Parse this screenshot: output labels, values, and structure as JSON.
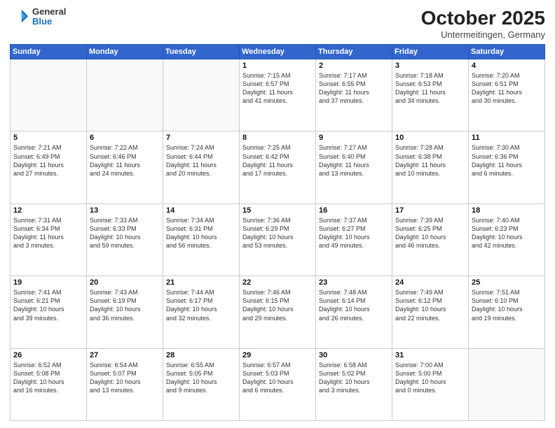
{
  "header": {
    "logo_general": "General",
    "logo_blue": "Blue",
    "title": "October 2025",
    "location": "Untermeitingen, Germany"
  },
  "days_of_week": [
    "Sunday",
    "Monday",
    "Tuesday",
    "Wednesday",
    "Thursday",
    "Friday",
    "Saturday"
  ],
  "weeks": [
    [
      {
        "day": "",
        "info": ""
      },
      {
        "day": "",
        "info": ""
      },
      {
        "day": "",
        "info": ""
      },
      {
        "day": "1",
        "info": "Sunrise: 7:15 AM\nSunset: 6:57 PM\nDaylight: 11 hours\nand 41 minutes."
      },
      {
        "day": "2",
        "info": "Sunrise: 7:17 AM\nSunset: 6:55 PM\nDaylight: 11 hours\nand 37 minutes."
      },
      {
        "day": "3",
        "info": "Sunrise: 7:18 AM\nSunset: 6:53 PM\nDaylight: 11 hours\nand 34 minutes."
      },
      {
        "day": "4",
        "info": "Sunrise: 7:20 AM\nSunset: 6:51 PM\nDaylight: 11 hours\nand 30 minutes."
      }
    ],
    [
      {
        "day": "5",
        "info": "Sunrise: 7:21 AM\nSunset: 6:49 PM\nDaylight: 11 hours\nand 27 minutes."
      },
      {
        "day": "6",
        "info": "Sunrise: 7:22 AM\nSunset: 6:46 PM\nDaylight: 11 hours\nand 24 minutes."
      },
      {
        "day": "7",
        "info": "Sunrise: 7:24 AM\nSunset: 6:44 PM\nDaylight: 11 hours\nand 20 minutes."
      },
      {
        "day": "8",
        "info": "Sunrise: 7:25 AM\nSunset: 6:42 PM\nDaylight: 11 hours\nand 17 minutes."
      },
      {
        "day": "9",
        "info": "Sunrise: 7:27 AM\nSunset: 6:40 PM\nDaylight: 11 hours\nand 13 minutes."
      },
      {
        "day": "10",
        "info": "Sunrise: 7:28 AM\nSunset: 6:38 PM\nDaylight: 11 hours\nand 10 minutes."
      },
      {
        "day": "11",
        "info": "Sunrise: 7:30 AM\nSunset: 6:36 PM\nDaylight: 11 hours\nand 6 minutes."
      }
    ],
    [
      {
        "day": "12",
        "info": "Sunrise: 7:31 AM\nSunset: 6:34 PM\nDaylight: 11 hours\nand 3 minutes."
      },
      {
        "day": "13",
        "info": "Sunrise: 7:33 AM\nSunset: 6:33 PM\nDaylight: 10 hours\nand 59 minutes."
      },
      {
        "day": "14",
        "info": "Sunrise: 7:34 AM\nSunset: 6:31 PM\nDaylight: 10 hours\nand 56 minutes."
      },
      {
        "day": "15",
        "info": "Sunrise: 7:36 AM\nSunset: 6:29 PM\nDaylight: 10 hours\nand 53 minutes."
      },
      {
        "day": "16",
        "info": "Sunrise: 7:37 AM\nSunset: 6:27 PM\nDaylight: 10 hours\nand 49 minutes."
      },
      {
        "day": "17",
        "info": "Sunrise: 7:39 AM\nSunset: 6:25 PM\nDaylight: 10 hours\nand 46 minutes."
      },
      {
        "day": "18",
        "info": "Sunrise: 7:40 AM\nSunset: 6:23 PM\nDaylight: 10 hours\nand 42 minutes."
      }
    ],
    [
      {
        "day": "19",
        "info": "Sunrise: 7:41 AM\nSunset: 6:21 PM\nDaylight: 10 hours\nand 39 minutes."
      },
      {
        "day": "20",
        "info": "Sunrise: 7:43 AM\nSunset: 6:19 PM\nDaylight: 10 hours\nand 36 minutes."
      },
      {
        "day": "21",
        "info": "Sunrise: 7:44 AM\nSunset: 6:17 PM\nDaylight: 10 hours\nand 32 minutes."
      },
      {
        "day": "22",
        "info": "Sunrise: 7:46 AM\nSunset: 6:15 PM\nDaylight: 10 hours\nand 29 minutes."
      },
      {
        "day": "23",
        "info": "Sunrise: 7:48 AM\nSunset: 6:14 PM\nDaylight: 10 hours\nand 26 minutes."
      },
      {
        "day": "24",
        "info": "Sunrise: 7:49 AM\nSunset: 6:12 PM\nDaylight: 10 hours\nand 22 minutes."
      },
      {
        "day": "25",
        "info": "Sunrise: 7:51 AM\nSunset: 6:10 PM\nDaylight: 10 hours\nand 19 minutes."
      }
    ],
    [
      {
        "day": "26",
        "info": "Sunrise: 6:52 AM\nSunset: 5:08 PM\nDaylight: 10 hours\nand 16 minutes."
      },
      {
        "day": "27",
        "info": "Sunrise: 6:54 AM\nSunset: 5:07 PM\nDaylight: 10 hours\nand 13 minutes."
      },
      {
        "day": "28",
        "info": "Sunrise: 6:55 AM\nSunset: 5:05 PM\nDaylight: 10 hours\nand 9 minutes."
      },
      {
        "day": "29",
        "info": "Sunrise: 6:57 AM\nSunset: 5:03 PM\nDaylight: 10 hours\nand 6 minutes."
      },
      {
        "day": "30",
        "info": "Sunrise: 6:58 AM\nSunset: 5:02 PM\nDaylight: 10 hours\nand 3 minutes."
      },
      {
        "day": "31",
        "info": "Sunrise: 7:00 AM\nSunset: 5:00 PM\nDaylight: 10 hours\nand 0 minutes."
      },
      {
        "day": "",
        "info": ""
      }
    ]
  ]
}
